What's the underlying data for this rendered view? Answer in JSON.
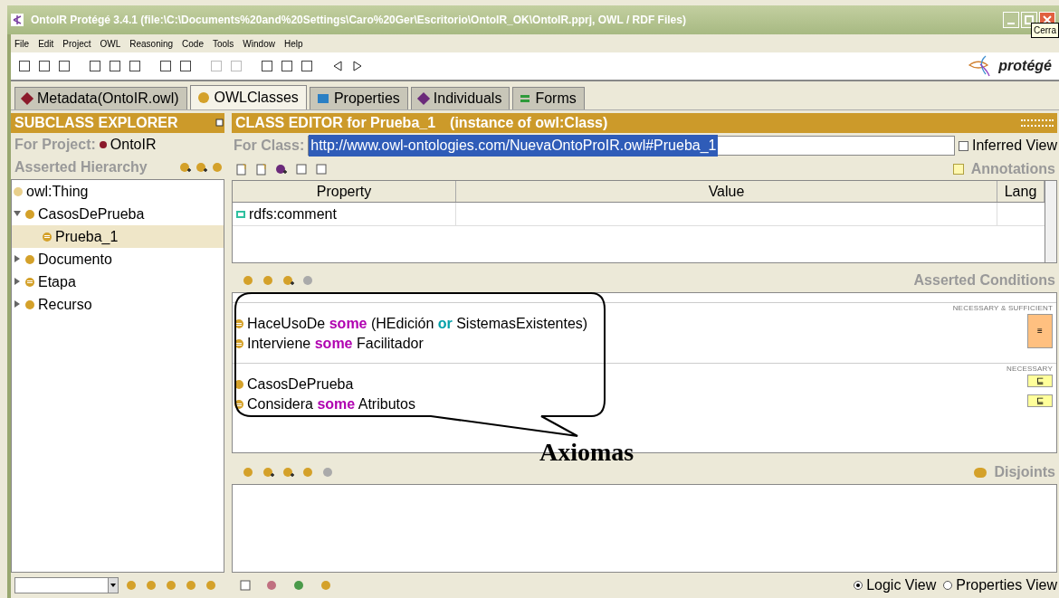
{
  "window": {
    "title": "OntoIR  Protégé 3.4.1     (file:\\C:\\Documents%20and%20Settings\\Caro%20Ger\\Escritorio\\OntoIR_OK\\OntoIR.pprj, OWL / RDF Files)",
    "tooltip": "Cerra"
  },
  "menu": [
    "File",
    "Edit",
    "Project",
    "OWL",
    "Reasoning",
    "Code",
    "Tools",
    "Window",
    "Help"
  ],
  "logo": "protégé",
  "tabs": [
    {
      "label": "Metadata(OntoIR.owl)",
      "selected": false,
      "kind": "diamond",
      "color": "#8b1a2b"
    },
    {
      "label": "OWLClasses",
      "selected": true,
      "kind": "dot",
      "color": "#d4a12a"
    },
    {
      "label": "Properties",
      "selected": false,
      "kind": "square",
      "color": "#2a7fc4"
    },
    {
      "label": "Individuals",
      "selected": false,
      "kind": "diamond",
      "color": "#6b2a7a"
    },
    {
      "label": "Forms",
      "selected": false,
      "kind": "lines",
      "color": "#2e9a3a"
    }
  ],
  "explorer": {
    "title": "SUBCLASS EXPLORER",
    "project_label": "For Project:",
    "project": "OntoIR",
    "hierarchy_label": "Asserted Hierarchy",
    "tree": [
      {
        "label": "owl:Thing",
        "kind": "thing",
        "selected": false
      },
      {
        "label": "CasosDePrueba",
        "kind": "class",
        "expanded": true,
        "selected": false,
        "children": [
          {
            "label": "Prueba_1",
            "kind": "defined",
            "selected": true
          }
        ]
      },
      {
        "label": "Documento",
        "kind": "class",
        "expanded": false,
        "selected": false
      },
      {
        "label": "Etapa",
        "kind": "defined",
        "expanded": false,
        "selected": false
      },
      {
        "label": "Recurso",
        "kind": "class",
        "expanded": false,
        "selected": false
      }
    ]
  },
  "editor": {
    "title": "CLASS EDITOR for Prueba_1",
    "subtitle": "(instance of owl:Class)",
    "for_class_label": "For Class:",
    "uri": "http://www.owl-ontologies.com/NuevaOntoProIR.owl#Prueba_1",
    "inferred_view": {
      "label": "Inferred View",
      "checked": false
    },
    "annotations_label": "Annotations",
    "columns": [
      "Property",
      "Value",
      "Lang"
    ],
    "rows": [
      {
        "property": "rdfs:comment"
      }
    ]
  },
  "conditions": {
    "title": "Asserted Conditions",
    "groups": [
      {
        "heading": "NECESSARY & SUFFICIENT",
        "marker": {
          "kind": "equivalent",
          "symbol": "≡"
        },
        "items": [
          {
            "kind": "restriction",
            "tokens": [
              {
                "text": "HaceUsoDe ",
                "kind": "plain"
              },
              {
                "text": "some",
                "kind": "keyword"
              },
              {
                "text": " (HEdición ",
                "kind": "plain"
              },
              {
                "text": "or",
                "kind": "operator"
              },
              {
                "text": " SistemasExistentes)",
                "kind": "plain"
              }
            ]
          },
          {
            "kind": "restriction",
            "tokens": [
              {
                "text": "Interviene ",
                "kind": "plain"
              },
              {
                "text": "some",
                "kind": "keyword"
              },
              {
                "text": " Facilitador",
                "kind": "plain"
              }
            ]
          }
        ]
      },
      {
        "heading": "NECESSARY",
        "items": [
          {
            "kind": "class",
            "marker": {
              "kind": "subclass",
              "symbol": "⊑"
            },
            "tokens": [
              {
                "text": "CasosDePrueba",
                "kind": "plain"
              }
            ]
          },
          {
            "kind": "restriction",
            "marker": {
              "kind": "subclass",
              "symbol": "⊑"
            },
            "tokens": [
              {
                "text": "Considera ",
                "kind": "plain"
              },
              {
                "text": "some",
                "kind": "keyword"
              },
              {
                "text": " Atributos",
                "kind": "plain"
              }
            ]
          }
        ]
      }
    ]
  },
  "callout": "Axiomas",
  "disjoints_label": "Disjoints",
  "views": [
    {
      "label": "Logic View",
      "selected": true
    },
    {
      "label": "Properties View",
      "selected": false
    }
  ]
}
